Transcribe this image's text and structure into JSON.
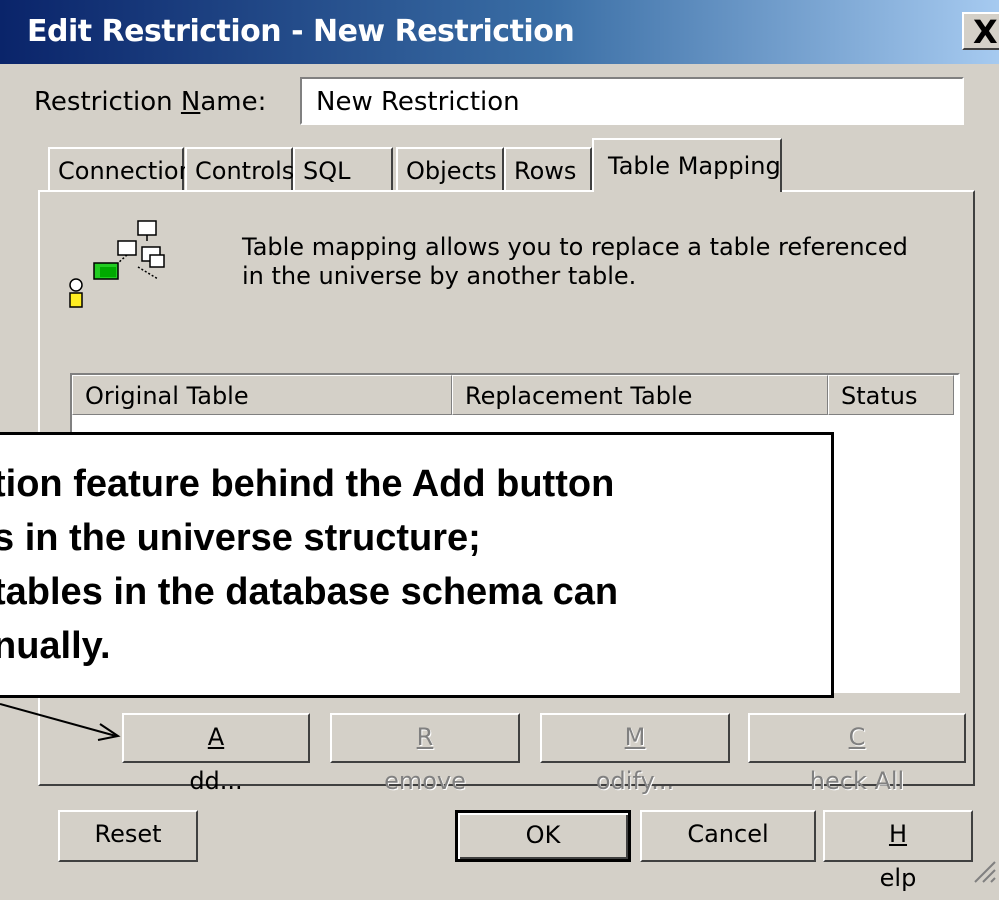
{
  "window": {
    "title": "Edit Restriction - New Restriction",
    "close_label": "X"
  },
  "restriction_name": {
    "label_before": "Restriction ",
    "label_mnemonic": "N",
    "label_after": "ame:",
    "value": "New Restriction"
  },
  "tabs": [
    {
      "label": "Connection"
    },
    {
      "label": "Controls"
    },
    {
      "label": "SQL"
    },
    {
      "label": "Objects"
    },
    {
      "label": "Rows"
    },
    {
      "label": "Table Mapping",
      "active": true
    }
  ],
  "description": "Table mapping allows you to replace a table referenced in the universe by another table.",
  "table": {
    "columns": [
      "Original Table",
      "Replacement Table",
      "Status"
    ],
    "rows": []
  },
  "panel_buttons": [
    {
      "mnemonic": "A",
      "rest": "dd...",
      "enabled": true
    },
    {
      "mnemonic": "R",
      "rest": "emove",
      "enabled": false
    },
    {
      "mnemonic": "M",
      "rest": "odify...",
      "enabled": false
    },
    {
      "mnemonic": "C",
      "rest": "heck All",
      "enabled": false
    }
  ],
  "footer_buttons": {
    "reset": "Reset",
    "ok": "OK",
    "cancel": "Cancel",
    "help_mnemonic": "H",
    "help_rest": "elp"
  },
  "callout": {
    "lines": [
      "tion feature behind the Add button",
      "s in the universe structure;",
      "tables in the database schema can",
      "nually."
    ]
  }
}
